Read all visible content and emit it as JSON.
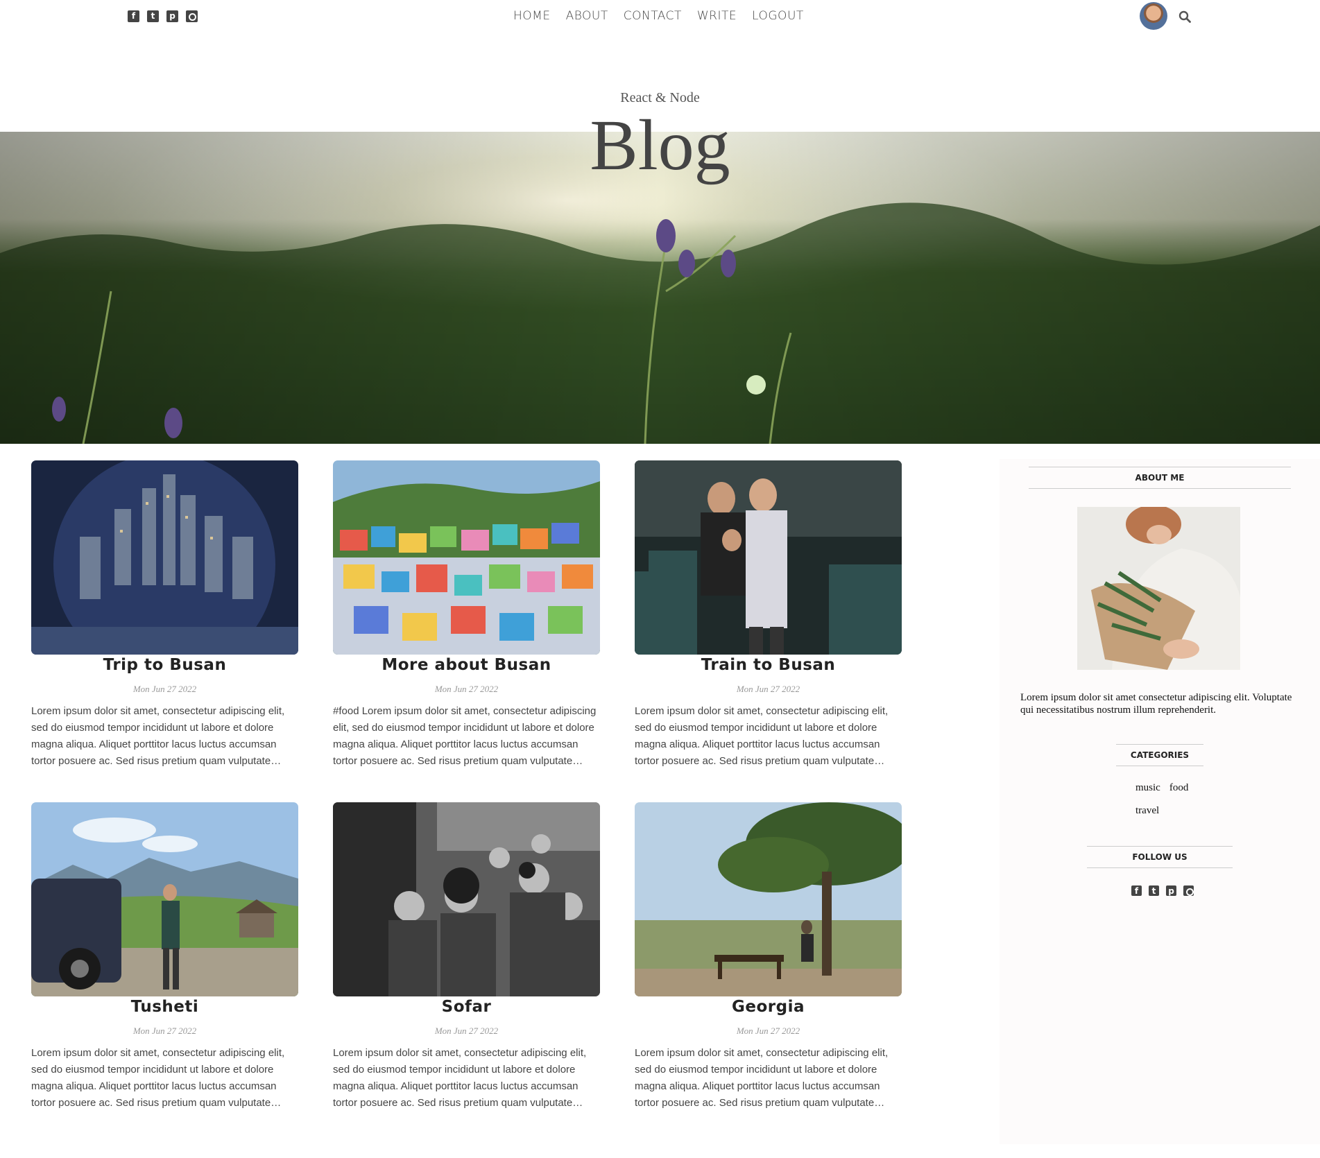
{
  "social": [
    "facebook-icon",
    "twitter-icon",
    "pinterest-icon",
    "instagram-icon"
  ],
  "nav": {
    "items": [
      "HOME",
      "ABOUT",
      "CONTACT",
      "WRITE",
      "LOGOUT"
    ]
  },
  "header": {
    "subtitle": "React & Node",
    "title": "Blog"
  },
  "posts": [
    {
      "title": "Trip to Busan",
      "date": "Mon Jun 27 2022",
      "excerpt": "Lorem ipsum dolor sit amet, consectetur adipiscing elit, sed do eiusmod tempor incididunt ut labore et dolore magna aliqua. Aliquet porttitor lacus luctus accumsan tortor posuere ac. Sed risus pretium quam vulputate dignissim suspendisse."
    },
    {
      "title": "More about Busan",
      "date": "Mon Jun 27 2022",
      "excerpt": "#food Lorem ipsum dolor sit amet, consectetur adipiscing elit, sed do eiusmod tempor incididunt ut labore et dolore magna aliqua. Aliquet porttitor lacus luctus accumsan tortor posuere ac. Sed risus pretium quam vulputate dignissim suspendisse."
    },
    {
      "title": "Train to Busan",
      "date": "Mon Jun 27 2022",
      "excerpt": "Lorem ipsum dolor sit amet, consectetur adipiscing elit, sed do eiusmod tempor incididunt ut labore et dolore magna aliqua. Aliquet porttitor lacus luctus accumsan tortor posuere ac. Sed risus pretium quam vulputate dignissim suspendisse."
    },
    {
      "title": "Tusheti",
      "date": "Mon Jun 27 2022",
      "excerpt": "Lorem ipsum dolor sit amet, consectetur adipiscing elit, sed do eiusmod tempor incididunt ut labore et dolore magna aliqua. Aliquet porttitor lacus luctus accumsan tortor posuere ac. Sed risus pretium quam vulputate dignissim suspendisse."
    },
    {
      "title": "Sofar",
      "date": "Mon Jun 27 2022",
      "excerpt": "Lorem ipsum dolor sit amet, consectetur adipiscing elit, sed do eiusmod tempor incididunt ut labore et dolore magna aliqua. Aliquet porttitor lacus luctus accumsan tortor posuere ac. Sed risus pretium quam vulputate dignissim suspendisse."
    },
    {
      "title": "Georgia",
      "date": "Mon Jun 27 2022",
      "excerpt": "Lorem ipsum dolor sit amet, consectetur adipiscing elit, sed do eiusmod tempor incididunt ut labore et dolore magna aliqua. Aliquet porttitor lacus luctus accumsan tortor posuere ac. Sed risus pretium quam vulputate dignissim suspendisse."
    }
  ],
  "sidebar": {
    "about_heading": "ABOUT ME",
    "about_text": "Lorem ipsum dolor sit amet consectetur adipiscing elit. Voluptate qui necessitatibus nostrum illum reprehenderit.",
    "categories_heading": "CATEGORIES",
    "categories": [
      "music",
      "food",
      "travel"
    ],
    "follow_heading": "FOLLOW US"
  }
}
